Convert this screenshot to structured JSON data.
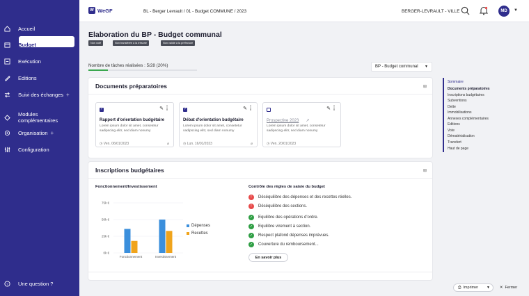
{
  "sidebar": {
    "items": [
      {
        "label": "Accueil",
        "icon": "home-icon"
      },
      {
        "label": "Budget",
        "icon": "budget-icon",
        "active": true
      },
      {
        "label": "Exécution",
        "icon": "execution-icon"
      },
      {
        "label": "Editions",
        "icon": "pencil-icon"
      },
      {
        "label": "Suivi des échanges",
        "icon": "exchange-icon",
        "expand": "+"
      },
      {
        "label": "Modules",
        "label2": "complémentaires",
        "icon": "modules-icon"
      },
      {
        "label": "Organisation",
        "icon": "organisation-icon",
        "expand": "+"
      },
      {
        "label": "Configuration",
        "icon": "sliders-icon"
      }
    ],
    "help": {
      "label": "Une question ?",
      "icon": "help-icon"
    }
  },
  "topbar": {
    "logo": "WeGF",
    "breadcrumb": "BL - Berger Levrault / 01 - Budget COMMUNE / 2023",
    "organisation": "BERGER-LEVRAULT - VILLE",
    "avatar": "MD"
  },
  "page": {
    "title": "Elaboration du BP - Budget communal",
    "badges": [
      "Non voté",
      "Non transférée à la trésorie",
      "Non validé à la préfecture"
    ],
    "progress_text": "Nombre de tâches réalisées : 5/28 (20%)",
    "progress_fraction": 0.18,
    "budget_select": "BP - Budget communal"
  },
  "documents": {
    "title": "Documents préparatoires",
    "cards": [
      {
        "title": "Rapport d'orientation budgétaire",
        "desc": "Lorem ipsum dolor sit amet, consetetur sadipscing elitr, sed diam nonumy",
        "date": "Ven. 06/01/2023",
        "checked": true,
        "link": false
      },
      {
        "title": "Débat d'orientation budgétaire",
        "desc": "Lorem ipsum dolor sit amet, consetetur sadipscing elitr, sed diam nonumy",
        "date": "Lun. 16/01/2023",
        "checked": true,
        "link": false
      },
      {
        "title": "Prospective 2023",
        "desc": "Lorem ipsum dolor sit amet, consetetur sadipscing elitr, sed diam nonumy",
        "date": "Ven. 20/01/2023",
        "checked": false,
        "link": true
      }
    ]
  },
  "inscriptions": {
    "title": "Inscriptions budgétaires",
    "chart_heading": "Fonctionnement/Investissement",
    "controls_heading": "Contrôle des règles de saisie du budget",
    "rules": [
      {
        "text": "Déséquilibre des dépenses et des recettes réelles.",
        "status": "error"
      },
      {
        "text": "Déséquilibre des sections.",
        "status": "error"
      },
      {
        "text": "Equilibre des opérations d'ordre.",
        "status": "ok"
      },
      {
        "text": "Equilibre virement à section.",
        "status": "ok"
      },
      {
        "text": "Respect plafond dépenses imprévues.",
        "status": "ok"
      },
      {
        "text": "Couverture du remboursement...",
        "status": "ok"
      }
    ],
    "learn_more": "En savoir plus"
  },
  "chart_data": {
    "type": "bar",
    "categories": [
      "Fonctionnement",
      "Investissement"
    ],
    "series": [
      {
        "name": "Dépenses",
        "values": [
          36000,
          50000
        ],
        "color": "#3b8fdc"
      },
      {
        "name": "Recettes",
        "values": [
          18000,
          33000
        ],
        "color": "#f0a41c"
      }
    ],
    "y_ticks": [
      "75k €",
      "50k €",
      "25k €",
      "0k €"
    ],
    "ylim": [
      0,
      75000
    ],
    "legend": "right"
  },
  "sommaire": {
    "title": "Sommaire",
    "items": [
      "Documents préparatoires",
      "Inscriptions budgétaires",
      "Subventions",
      "Dette",
      "Immobilisations",
      "Annexes complémentaires",
      "Editions",
      "Vote",
      "Dématérialisation",
      "Transfert"
    ],
    "top": "Haut de page"
  },
  "footer": {
    "print": "Imprimer",
    "close": "Fermer"
  }
}
